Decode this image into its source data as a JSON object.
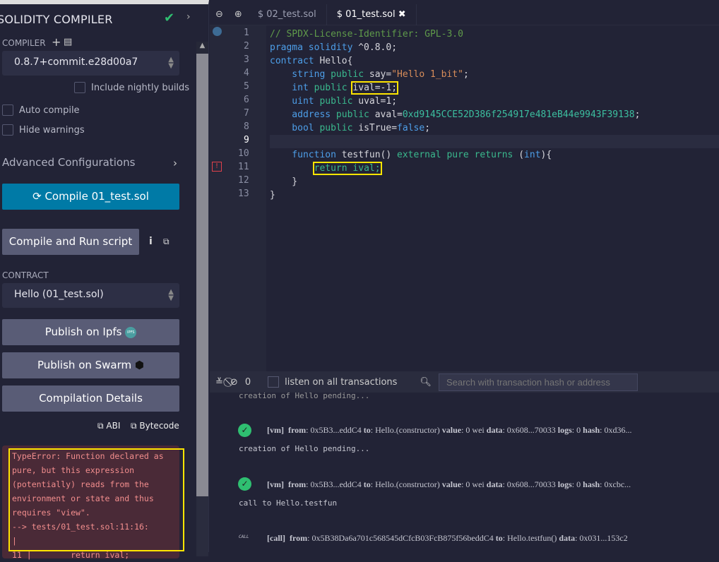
{
  "sidebar": {
    "title": "SOLIDITY COMPILER",
    "compiler_label": "COMPILER",
    "compiler_version": "0.8.7+commit.e28d00a7",
    "nightly": "Include nightly builds",
    "auto_compile": "Auto compile",
    "hide_warnings": "Hide warnings",
    "advanced": "Advanced Configurations",
    "compile_btn": "Compile 01_test.sol",
    "run_btn": "Compile and Run script",
    "contract_label": "CONTRACT",
    "contract": "Hello (01_test.sol)",
    "ipfs": "Publish on Ipfs",
    "ipfs_badge": "IPFS",
    "swarm": "Publish on Swarm",
    "details": "Compilation Details",
    "abi": "ABI",
    "bytecode": "Bytecode",
    "error": [
      "TypeError: Function declared as",
      "pure, but this expression",
      "(potentially) reads from the",
      "environment or state and thus",
      "requires \"view\".",
      "--> tests/01_test.sol:11:16:",
      "|",
      "11 |        return ival;"
    ]
  },
  "editor": {
    "tabs": [
      "02_test.sol",
      "01_test.sol"
    ],
    "lines": [
      [
        [
          "// SPDX-License-Identifier: GPL-3.0",
          "c"
        ]
      ],
      [
        [
          "pragma solidity",
          "k"
        ],
        [
          " ^0.8.0;",
          "p"
        ]
      ],
      [
        [
          "contract",
          "k"
        ],
        [
          " Hello{",
          "p"
        ]
      ],
      [
        [
          "    string",
          "k"
        ],
        [
          " public",
          "g"
        ],
        [
          " say=",
          "p"
        ],
        [
          "\"Hello 1_bit\"",
          "s"
        ],
        [
          ";",
          "p"
        ]
      ],
      [
        [
          "    int",
          "k"
        ],
        [
          " public",
          "g"
        ],
        [
          " ",
          "p"
        ],
        [
          "ival=-1;",
          "p hl"
        ]
      ],
      [
        [
          "    uint",
          "k"
        ],
        [
          " public",
          "g"
        ],
        [
          " uval=1;",
          "p"
        ]
      ],
      [
        [
          "    address",
          "k"
        ],
        [
          " public",
          "g"
        ],
        [
          " aval=",
          "p"
        ],
        [
          "0xd9145CCE52D386f254917e481eB44e9943F39138",
          "n"
        ],
        [
          ";",
          "p"
        ]
      ],
      [
        [
          "    bool",
          "k"
        ],
        [
          " public",
          "g"
        ],
        [
          " isTrue=",
          "p"
        ],
        [
          "false",
          "k"
        ],
        [
          ";",
          "p"
        ]
      ],
      [
        [
          "",
          "p"
        ]
      ],
      [
        [
          "    function",
          "k"
        ],
        [
          " testfun() ",
          "p"
        ],
        [
          "external pure returns",
          "g"
        ],
        [
          " (",
          "p"
        ],
        [
          "int",
          "k"
        ],
        [
          "){",
          "p"
        ]
      ],
      [
        [
          "        ",
          "p"
        ],
        [
          "return ival;",
          "g hl"
        ]
      ],
      [
        [
          "    }",
          "p"
        ]
      ],
      [
        [
          "}",
          "p"
        ]
      ]
    ]
  },
  "terminal": {
    "count": "0",
    "listen": "listen on all transactions",
    "search_placeholder": "Search with transaction hash or address",
    "msg0": "creation of Hello pending...",
    "tx1": {
      "tag": "[vm]",
      "from_l": "from",
      "from": ": 0x5B3...eddC4 ",
      "to_l": "to",
      "to": ": Hello.(constructor) ",
      "value_l": "value",
      "value": ": 0 wei ",
      "data_l": "data",
      "data": ": 0x608...70033 ",
      "logs_l": "logs",
      "logs": ": 0 ",
      "hash_l": "hash",
      "hash": ": 0xd36..."
    },
    "msg1": "creation of Hello pending...",
    "tx2": {
      "tag": "[vm]",
      "from_l": "from",
      "from": ": 0x5B3...eddC4 ",
      "to_l": "to",
      "to": ": Hello.(constructor) ",
      "value_l": "value",
      "value": ": 0 wei ",
      "data_l": "data",
      "data": ": 0x608...70033 ",
      "logs_l": "logs",
      "logs": ": 0 ",
      "hash_l": "hash",
      "hash": ": 0xcbc..."
    },
    "msg2": "call to Hello.testfun",
    "call_icon": "CALL",
    "tx3": {
      "tag": "[call]",
      "from_l": "from",
      "from": ": 0x5B38Da6a701c568545dCfcB03FcB875f56beddC4 ",
      "to_l": "to",
      "to": ": Hello.testfun() ",
      "data_l": "data",
      "data": ": 0x031...153c2"
    }
  }
}
